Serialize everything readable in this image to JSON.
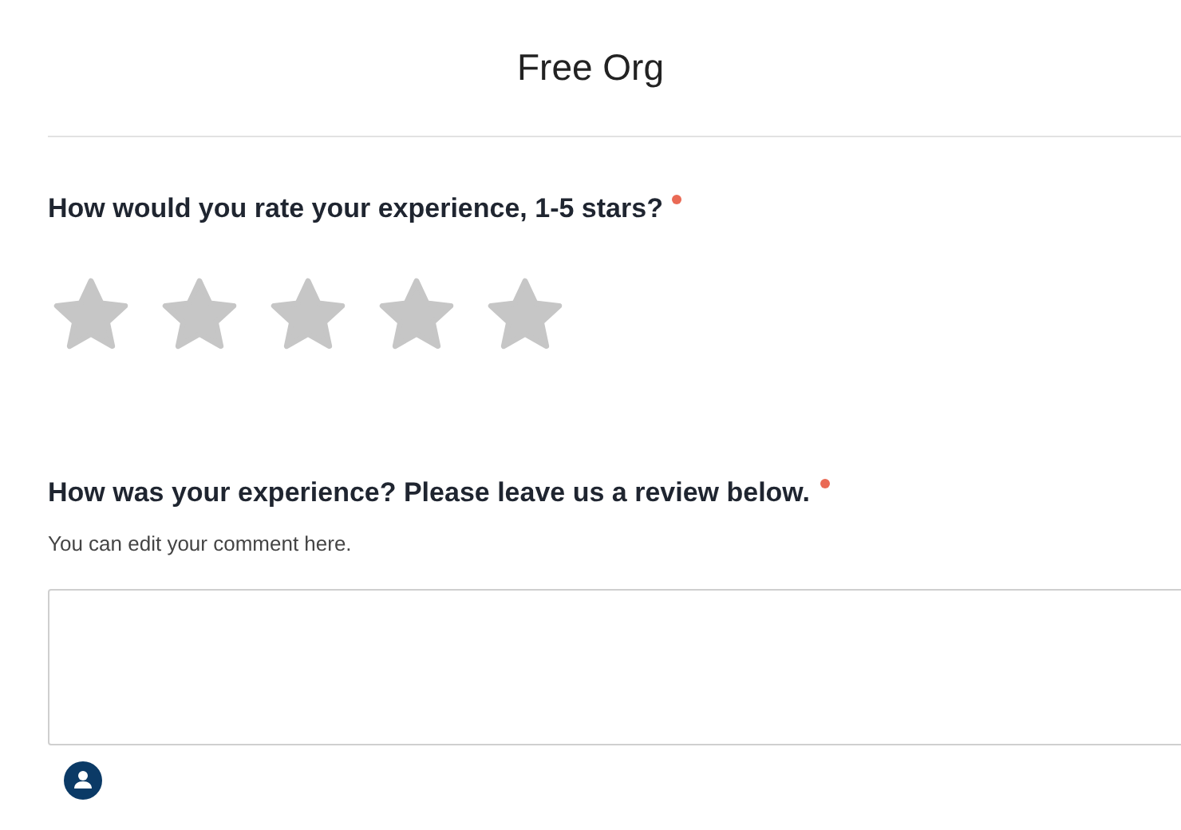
{
  "header": {
    "title": "Free Org"
  },
  "questions": [
    {
      "kind": "rating",
      "label": "How would you rate your experience, 1-5 stars?",
      "required": true,
      "stars": 0
    },
    {
      "kind": "comment",
      "label": "How was your experience? Please leave us a review below.",
      "required": true,
      "hint": "You can edit your comment here."
    }
  ]
}
